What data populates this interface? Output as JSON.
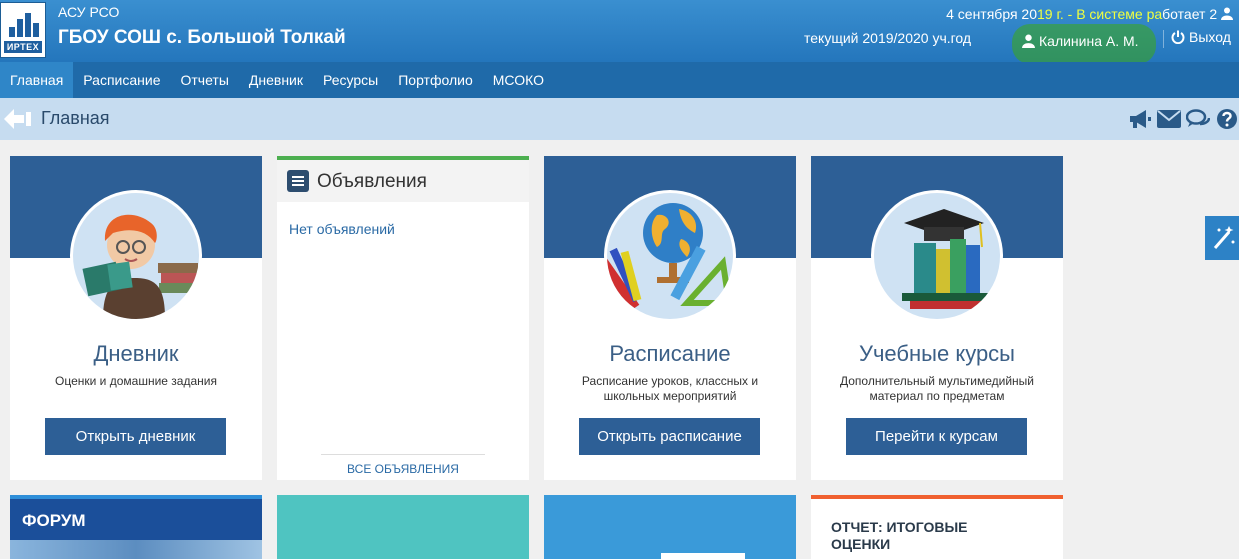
{
  "header": {
    "logo_text": "ИРТЕХ",
    "system_name": "АСУ РСО",
    "school_name": "ГБОУ СОШ с. Большой Толкай",
    "date_text": "4 сентября 20",
    "date_highlight": "19 г. - В системе ра",
    "date_rest": "ботает 2",
    "academic_year": "текущий 2019/2020 уч.год",
    "user_name": "Калинина А. М.",
    "logout_label": "Выход"
  },
  "nav": {
    "items": [
      "Главная",
      "Расписание",
      "Отчеты",
      "Дневник",
      "Ресурсы",
      "Портфолио",
      "МСОКО"
    ],
    "active": "Главная"
  },
  "page": {
    "title": "Главная"
  },
  "cards": {
    "diary": {
      "title": "Дневник",
      "subtitle": "Оценки и домашние задания",
      "button": "Открыть дневник"
    },
    "announcements": {
      "title": "Объявления",
      "empty": "Нет объявлений",
      "all_link": "ВСЕ ОБЪЯВЛЕНИЯ"
    },
    "schedule": {
      "title": "Расписание",
      "subtitle_1": "Расписание уроков, классных и",
      "subtitle_2": "школьных мероприятий",
      "button": "Открыть расписание"
    },
    "courses": {
      "title": "Учебные курсы",
      "subtitle_1": "Дополнительный мультимедийный",
      "subtitle_2": "материал по предметам",
      "button": "Перейти к курсам"
    }
  },
  "bottom": {
    "forum": "ФОРУМ",
    "report_1": "ОТЧЕТ: ИТОГОВЫЕ",
    "report_2": "ОЦЕНКИ"
  },
  "colors": {
    "header": "#2476bc",
    "nav": "#1f6aa9",
    "card_band": "#2d5f96",
    "highlight": "#3caa14"
  }
}
